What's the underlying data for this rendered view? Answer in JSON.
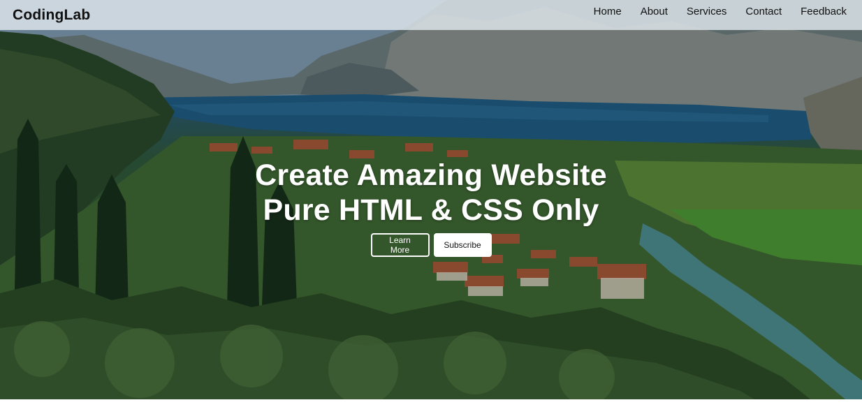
{
  "brand": {
    "logo": "CodingLab"
  },
  "nav": {
    "links": [
      "Home",
      "About",
      "Services",
      "Contact",
      "Feedback"
    ]
  },
  "hero": {
    "headline_line1": "Create Amazing Website",
    "headline_line2": "Pure HTML & CSS Only",
    "primary_button": "Learn More",
    "secondary_button": "Subscribe"
  },
  "colors": {
    "text_light": "#ffffff",
    "text_dark": "#111111",
    "navbar_bg": "#e1e8ee"
  }
}
